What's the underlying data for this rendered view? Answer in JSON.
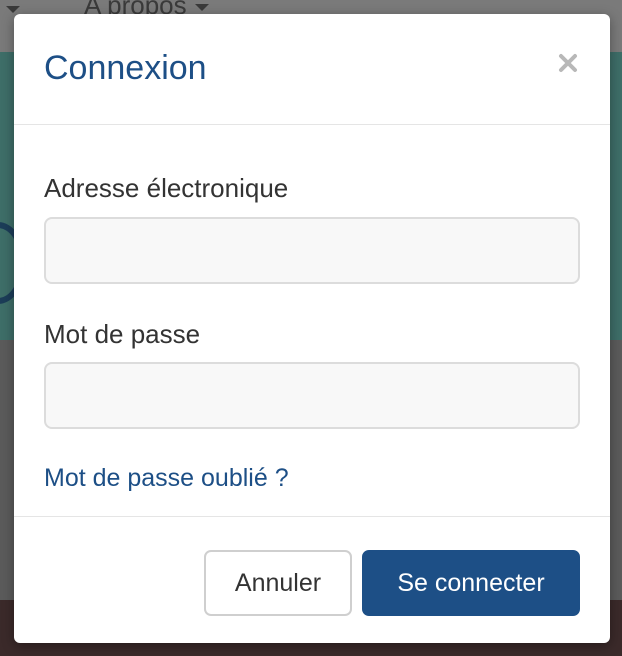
{
  "background": {
    "nav_item_label": "A propos"
  },
  "modal": {
    "title": "Connexion",
    "close_icon": "close-icon",
    "email": {
      "label": "Adresse électronique",
      "value": "",
      "placeholder": ""
    },
    "password": {
      "label": "Mot de passe",
      "value": "",
      "placeholder": ""
    },
    "forgot_link": "Mot de passe oublié ?",
    "cancel_label": "Annuler",
    "submit_label": "Se connecter"
  },
  "colors": {
    "accent": "#1d4f86",
    "input_bg": "#f8f8f8",
    "input_border": "#dcdcdc"
  }
}
